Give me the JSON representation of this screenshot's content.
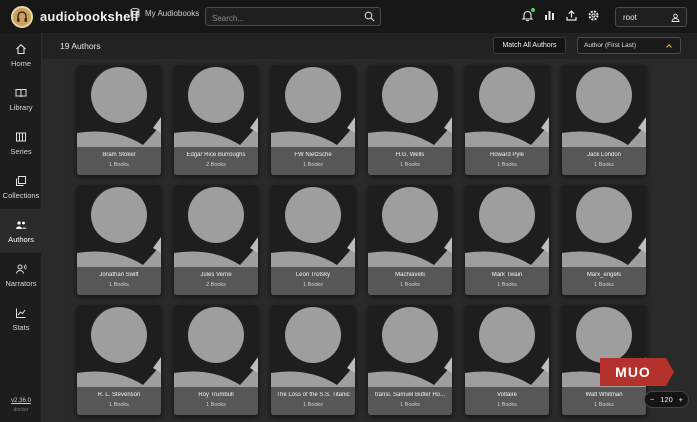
{
  "app": {
    "title": "audiobookshelf",
    "library": "My Audiobooks",
    "search_placeholder": "Search...",
    "user": "root",
    "version": "v2.36.0",
    "build": "docker"
  },
  "icons": {
    "logo": "audiobookshelf-logo-icon",
    "library": "database-icon",
    "search": "search-icon",
    "notifications": "bell-icon",
    "stats": "bar-chart-icon",
    "upload": "upload-icon",
    "settings": "gear-icon",
    "account": "user-icon"
  },
  "sidebar": {
    "items": [
      {
        "label": "Home",
        "icon": "home-icon",
        "active": false
      },
      {
        "label": "Library",
        "icon": "book-open-icon",
        "active": false
      },
      {
        "label": "Series",
        "icon": "columns-icon",
        "active": false
      },
      {
        "label": "Collections",
        "icon": "collections-icon",
        "active": false
      },
      {
        "label": "Authors",
        "icon": "people-icon",
        "active": true
      },
      {
        "label": "Narrators",
        "icon": "microphone-icon",
        "active": false
      },
      {
        "label": "Stats",
        "icon": "line-chart-icon",
        "active": false
      }
    ]
  },
  "toolbar": {
    "count": "19 Authors",
    "match_all": "Match All Authors",
    "sort": "Author (First Last)"
  },
  "authors": [
    {
      "name": "Bram Stoker",
      "books": "1 Books"
    },
    {
      "name": "Edgar Rice Burroughs",
      "books": "2 Books"
    },
    {
      "name": "FW Nietzsche",
      "books": "1 Books"
    },
    {
      "name": "H.G. Wells",
      "books": "1 Books"
    },
    {
      "name": "Howard Pyle",
      "books": "1 Books"
    },
    {
      "name": "Jack London",
      "books": "1 Books"
    },
    {
      "name": "Jonathan Swift",
      "books": "1 Books"
    },
    {
      "name": "Jules Verne",
      "books": "2 Books"
    },
    {
      "name": "Leon Trotsky",
      "books": "1 Books"
    },
    {
      "name": "Machiavelli",
      "books": "1 Books"
    },
    {
      "name": "Mark Twain",
      "books": "1 Books"
    },
    {
      "name": "Marx_engels",
      "books": "1 Books"
    },
    {
      "name": "R. L. Stevenson",
      "books": "1 Books"
    },
    {
      "name": "Roy Trumbull",
      "books": "1 Books"
    },
    {
      "name": "The Loss of the S.S. Titanic",
      "books": "1 Books"
    },
    {
      "name": "transl. Samuel Butler Ho...",
      "books": "1 Books"
    },
    {
      "name": "Voltaire",
      "books": "1 Books"
    },
    {
      "name": "Walt Whitman",
      "books": "1 Books"
    }
  ],
  "watermark": "MUO",
  "zoom": {
    "value": "120",
    "minus": "−",
    "plus": "+"
  },
  "colors": {
    "accent": "#c9a15a",
    "notification_dot": "#4bd26b",
    "watermark": "#b5312b"
  }
}
